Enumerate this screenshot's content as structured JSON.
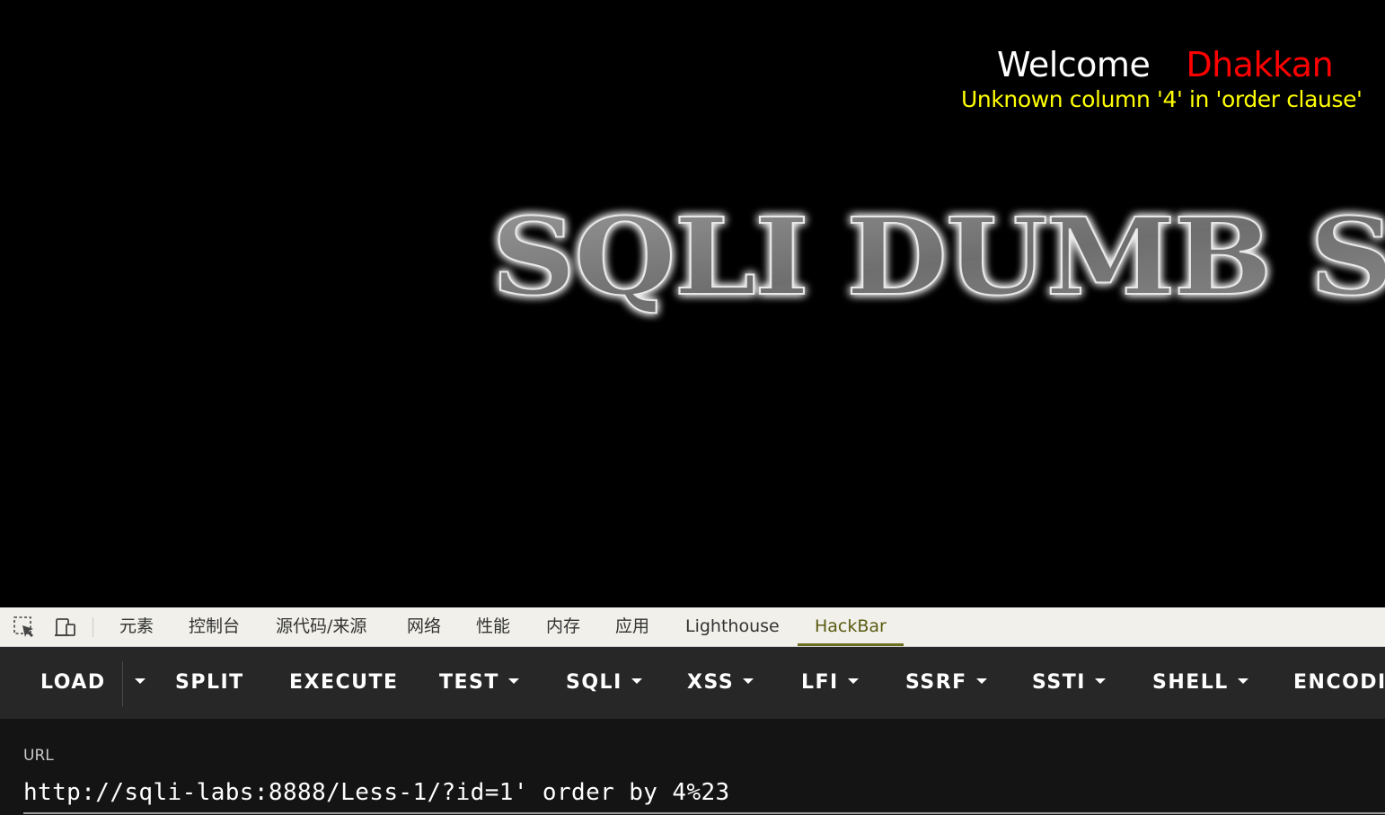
{
  "page": {
    "welcome_label": "Welcome",
    "username": "Dhakkan",
    "error_message": "Unknown column '4' in 'order clause'",
    "banner_text": "SQLI DUMB SE",
    "colors": {
      "background": "#000000",
      "welcome": "#ffffff",
      "username": "#ff0000",
      "error": "#ffff00"
    }
  },
  "devtools": {
    "icons": [
      "inspect-element-icon",
      "device-toolbar-icon"
    ],
    "tabs": [
      {
        "label": "元素",
        "active": false
      },
      {
        "label": "控制台",
        "active": false
      },
      {
        "label": "源代码/来源",
        "active": false
      },
      {
        "label": "网络",
        "active": false
      },
      {
        "label": "性能",
        "active": false
      },
      {
        "label": "内存",
        "active": false
      },
      {
        "label": "应用",
        "active": false
      },
      {
        "label": "Lighthouse",
        "active": false
      },
      {
        "label": "HackBar",
        "active": true
      }
    ]
  },
  "hackbar": {
    "buttons": {
      "load": "LOAD",
      "split": "SPLIT",
      "execute": "EXECUTE",
      "test": "TEST",
      "sqli": "SQLI",
      "xss": "XSS",
      "lfi": "LFI",
      "ssrf": "SSRF",
      "ssti": "SSTI",
      "shell": "SHELL",
      "encoding": "ENCODIN"
    },
    "url_label": "URL",
    "url_value": "http://sqli-labs:8888/Less-1/?id=1' order by 4%23"
  }
}
